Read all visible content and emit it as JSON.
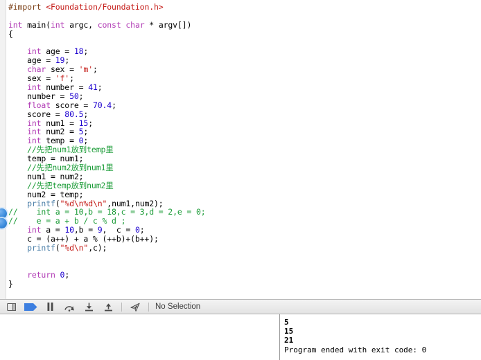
{
  "editor": {
    "language": "objective-c",
    "colors": {
      "keyword": "#b13bb5",
      "preprocessor": "#7b3f16",
      "string": "#c41a16",
      "number": "#1c00cf",
      "comment": "#1a9b36",
      "function": "#4b7fa8",
      "background": "#ffffff",
      "gutter": "#f2f2f2",
      "fold_marker": "#3d8ddd"
    },
    "lines": [
      {
        "n": 1,
        "segments": [
          {
            "t": "#import ",
            "c": "pre"
          },
          {
            "t": "<Foundation/Foundation.h>",
            "c": "hdr"
          }
        ]
      },
      {
        "n": 2,
        "segments": []
      },
      {
        "n": 3,
        "segments": [
          {
            "t": "int",
            "c": "kw"
          },
          {
            "t": " main(",
            "c": ""
          },
          {
            "t": "int",
            "c": "kw"
          },
          {
            "t": " argc, ",
            "c": ""
          },
          {
            "t": "const",
            "c": "kw"
          },
          {
            "t": " ",
            "c": ""
          },
          {
            "t": "char",
            "c": "kw"
          },
          {
            "t": " * argv[])",
            "c": ""
          }
        ]
      },
      {
        "n": 4,
        "segments": [
          {
            "t": "{",
            "c": ""
          }
        ]
      },
      {
        "n": 5,
        "segments": []
      },
      {
        "n": 6,
        "segments": [
          {
            "t": "    ",
            "c": ""
          },
          {
            "t": "int",
            "c": "kw"
          },
          {
            "t": " age = ",
            "c": ""
          },
          {
            "t": "18",
            "c": "num"
          },
          {
            "t": ";",
            "c": ""
          }
        ]
      },
      {
        "n": 7,
        "segments": [
          {
            "t": "    age = ",
            "c": ""
          },
          {
            "t": "19",
            "c": "num"
          },
          {
            "t": ";",
            "c": ""
          }
        ]
      },
      {
        "n": 8,
        "segments": [
          {
            "t": "    ",
            "c": ""
          },
          {
            "t": "char",
            "c": "kw"
          },
          {
            "t": " sex = ",
            "c": ""
          },
          {
            "t": "'m'",
            "c": "str"
          },
          {
            "t": ";",
            "c": ""
          }
        ]
      },
      {
        "n": 9,
        "segments": [
          {
            "t": "    sex = ",
            "c": ""
          },
          {
            "t": "'f'",
            "c": "str"
          },
          {
            "t": ";",
            "c": ""
          }
        ]
      },
      {
        "n": 10,
        "segments": [
          {
            "t": "    ",
            "c": ""
          },
          {
            "t": "int",
            "c": "kw"
          },
          {
            "t": " number = ",
            "c": ""
          },
          {
            "t": "41",
            "c": "num"
          },
          {
            "t": ";",
            "c": ""
          }
        ]
      },
      {
        "n": 11,
        "segments": [
          {
            "t": "    number = ",
            "c": ""
          },
          {
            "t": "50",
            "c": "num"
          },
          {
            "t": ";",
            "c": ""
          }
        ]
      },
      {
        "n": 12,
        "segments": [
          {
            "t": "    ",
            "c": ""
          },
          {
            "t": "float",
            "c": "kw"
          },
          {
            "t": " score = ",
            "c": ""
          },
          {
            "t": "70.4",
            "c": "num"
          },
          {
            "t": ";",
            "c": ""
          }
        ]
      },
      {
        "n": 13,
        "segments": [
          {
            "t": "    score = ",
            "c": ""
          },
          {
            "t": "80.5",
            "c": "num"
          },
          {
            "t": ";",
            "c": ""
          }
        ]
      },
      {
        "n": 14,
        "segments": [
          {
            "t": "    ",
            "c": ""
          },
          {
            "t": "int",
            "c": "kw"
          },
          {
            "t": " num1 = ",
            "c": ""
          },
          {
            "t": "15",
            "c": "num"
          },
          {
            "t": ";",
            "c": ""
          }
        ]
      },
      {
        "n": 15,
        "segments": [
          {
            "t": "    ",
            "c": ""
          },
          {
            "t": "int",
            "c": "kw"
          },
          {
            "t": " num2 = ",
            "c": ""
          },
          {
            "t": "5",
            "c": "num"
          },
          {
            "t": ";",
            "c": ""
          }
        ]
      },
      {
        "n": 16,
        "segments": [
          {
            "t": "    ",
            "c": ""
          },
          {
            "t": "int",
            "c": "kw"
          },
          {
            "t": " temp = ",
            "c": ""
          },
          {
            "t": "0",
            "c": "num"
          },
          {
            "t": ";",
            "c": ""
          }
        ]
      },
      {
        "n": 17,
        "segments": [
          {
            "t": "    ",
            "c": ""
          },
          {
            "t": "//先把num1放到temp里",
            "c": "cmt"
          }
        ]
      },
      {
        "n": 18,
        "segments": [
          {
            "t": "    temp = num1;",
            "c": ""
          }
        ]
      },
      {
        "n": 19,
        "segments": [
          {
            "t": "    ",
            "c": ""
          },
          {
            "t": "//先把num2放到num1里",
            "c": "cmt"
          }
        ]
      },
      {
        "n": 20,
        "segments": [
          {
            "t": "    num1 = num2;",
            "c": ""
          }
        ]
      },
      {
        "n": 21,
        "segments": [
          {
            "t": "    ",
            "c": ""
          },
          {
            "t": "//先把temp放到num2里",
            "c": "cmt"
          }
        ]
      },
      {
        "n": 22,
        "segments": [
          {
            "t": "    num2 = temp;",
            "c": ""
          }
        ]
      },
      {
        "n": 23,
        "segments": [
          {
            "t": "    ",
            "c": ""
          },
          {
            "t": "printf",
            "c": "fn"
          },
          {
            "t": "(",
            "c": ""
          },
          {
            "t": "\"%d\\n%d\\n\"",
            "c": "str"
          },
          {
            "t": ",num1,num2);",
            "c": ""
          }
        ]
      },
      {
        "n": 24,
        "segments": [
          {
            "t": "//    int a = 10,b = 18,c = 3,d = 2,e = 0;",
            "c": "cmt"
          }
        ]
      },
      {
        "n": 25,
        "segments": [
          {
            "t": "//    e = a + b / c % d ;",
            "c": "cmt"
          }
        ]
      },
      {
        "n": 26,
        "segments": [
          {
            "t": "    ",
            "c": ""
          },
          {
            "t": "int",
            "c": "kw"
          },
          {
            "t": " a = ",
            "c": ""
          },
          {
            "t": "10",
            "c": "num"
          },
          {
            "t": ",b = ",
            "c": ""
          },
          {
            "t": "9",
            "c": "num"
          },
          {
            "t": ",  c = ",
            "c": ""
          },
          {
            "t": "0",
            "c": "num"
          },
          {
            "t": ";",
            "c": ""
          }
        ]
      },
      {
        "n": 27,
        "segments": [
          {
            "t": "    c = (a++) + a % (++b)+(b++);",
            "c": ""
          }
        ]
      },
      {
        "n": 28,
        "segments": [
          {
            "t": "    ",
            "c": ""
          },
          {
            "t": "printf",
            "c": "fn"
          },
          {
            "t": "(",
            "c": ""
          },
          {
            "t": "\"%d\\n\"",
            "c": "str"
          },
          {
            "t": ",c);",
            "c": ""
          }
        ]
      },
      {
        "n": 29,
        "segments": []
      },
      {
        "n": 30,
        "segments": []
      },
      {
        "n": 31,
        "segments": [
          {
            "t": "    ",
            "c": ""
          },
          {
            "t": "return",
            "c": "kw"
          },
          {
            "t": " ",
            "c": ""
          },
          {
            "t": "0",
            "c": "num"
          },
          {
            "t": ";",
            "c": ""
          }
        ]
      },
      {
        "n": 32,
        "segments": [
          {
            "t": "}",
            "c": ""
          }
        ]
      }
    ]
  },
  "debug_bar": {
    "toggle_console_label": "toggle-console",
    "breakpoints_label": "breakpoints-activate",
    "pause_label": "pause",
    "step_over_label": "step-over",
    "step_into_label": "step-into",
    "step_out_label": "step-out",
    "location_label": "simulate-location",
    "selection_status": "No Selection"
  },
  "console": {
    "lines": [
      {
        "text": "5",
        "bold": true
      },
      {
        "text": "15",
        "bold": true
      },
      {
        "text": "21",
        "bold": true
      },
      {
        "text": "Program ended with exit code: 0",
        "bold": false
      }
    ]
  }
}
